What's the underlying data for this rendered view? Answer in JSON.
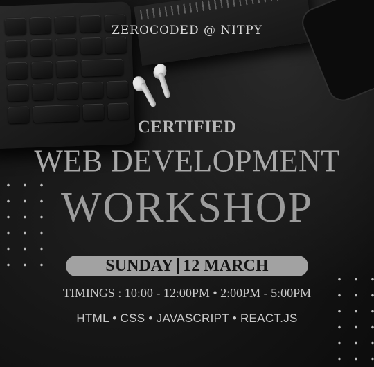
{
  "poster": {
    "brand": "ZEROCODED @ NITPY",
    "certified": "CERTIFIED",
    "title_line1": "WEB DEVELOPMENT",
    "title_line2": "WORKSHOP",
    "day": "SUNDAY",
    "date": "12 MARCH",
    "timings": "TIMINGS : 10:00  - 12:00PM • 2:00PM - 5:00PM",
    "topics": "HTML • CSS • JAVASCRIPT • REACT.JS"
  },
  "icons": [
    "keyboard-icon",
    "notebook-icon",
    "phone-icon",
    "airpods-icon"
  ],
  "colors": {
    "background": "#111111",
    "title": "#a9a9a9",
    "pill": "#a2a2a2",
    "pill_text": "#141414"
  }
}
